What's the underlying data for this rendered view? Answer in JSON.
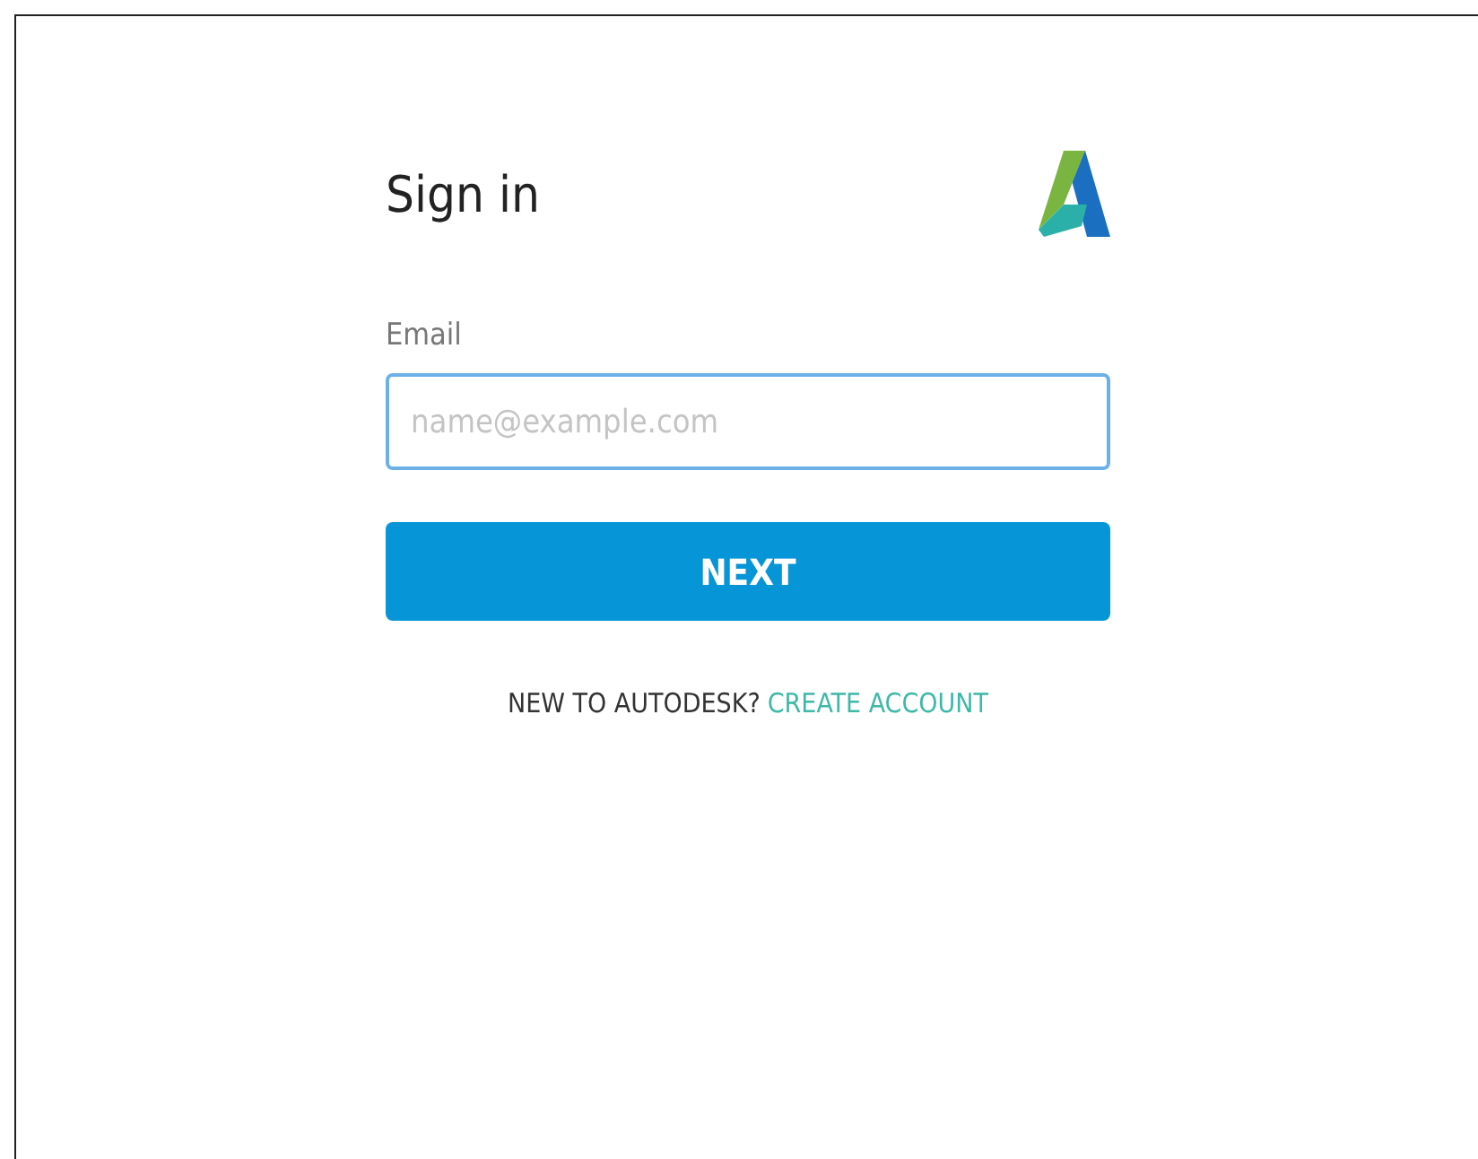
{
  "title": "Sign in",
  "email": {
    "label": "Email",
    "placeholder": "name@example.com"
  },
  "next_button": "NEXT",
  "footer": {
    "prompt": "NEW TO AUTODESK?",
    "link": "CREATE ACCOUNT"
  }
}
